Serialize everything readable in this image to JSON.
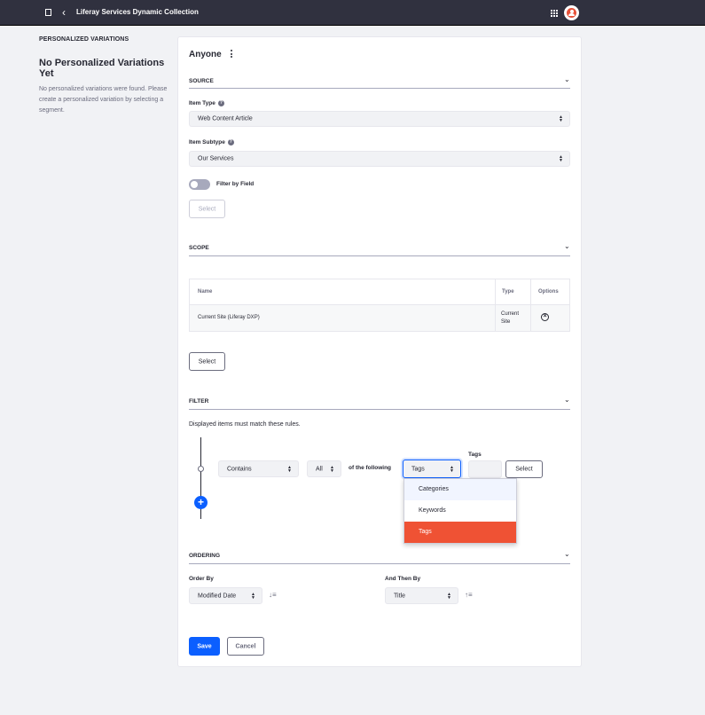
{
  "topbar": {
    "title": "Liferay Services Dynamic Collection"
  },
  "sidebar": {
    "label": "PERSONALIZED VARIATIONS",
    "empty_title": "No Personalized Variations Yet",
    "empty_text": "No personalized variations were found. Please create a personalized variation by selecting a segment."
  },
  "variation": {
    "title": "Anyone"
  },
  "source": {
    "title": "SOURCE",
    "item_type_label": "Item Type",
    "item_type_value": "Web Content Article",
    "item_subtype_label": "Item Subtype",
    "item_subtype_value": "Our Services",
    "filter_by_field_label": "Filter by Field",
    "select_label": "Select"
  },
  "scope": {
    "title": "SCOPE",
    "columns": [
      "Name",
      "Type",
      "Options"
    ],
    "rows": [
      {
        "name": "Current Site (Liferay DXP)",
        "type_line1": "Current",
        "type_line2": "Site"
      }
    ],
    "select_label": "Select"
  },
  "filter": {
    "title": "FILTER",
    "description": "Displayed items must match these rules.",
    "operator": "Contains",
    "quantifier": "All",
    "of_following": "of the following",
    "field_type": "Tags",
    "tags_label": "Tags",
    "select_label": "Select",
    "dropdown_options": [
      "Categories",
      "Keywords",
      "Tags"
    ],
    "dropdown_selected": "Tags"
  },
  "ordering": {
    "title": "ORDERING",
    "order_by_label": "Order By",
    "order_by_value": "Modified Date",
    "then_by_label": "And Then By",
    "then_by_value": "Title"
  },
  "actions": {
    "save_label": "Save",
    "cancel_label": "Cancel"
  },
  "colors": {
    "primary": "#0b5fff",
    "selected_option": "#ef5234",
    "topbar": "#30313f"
  }
}
